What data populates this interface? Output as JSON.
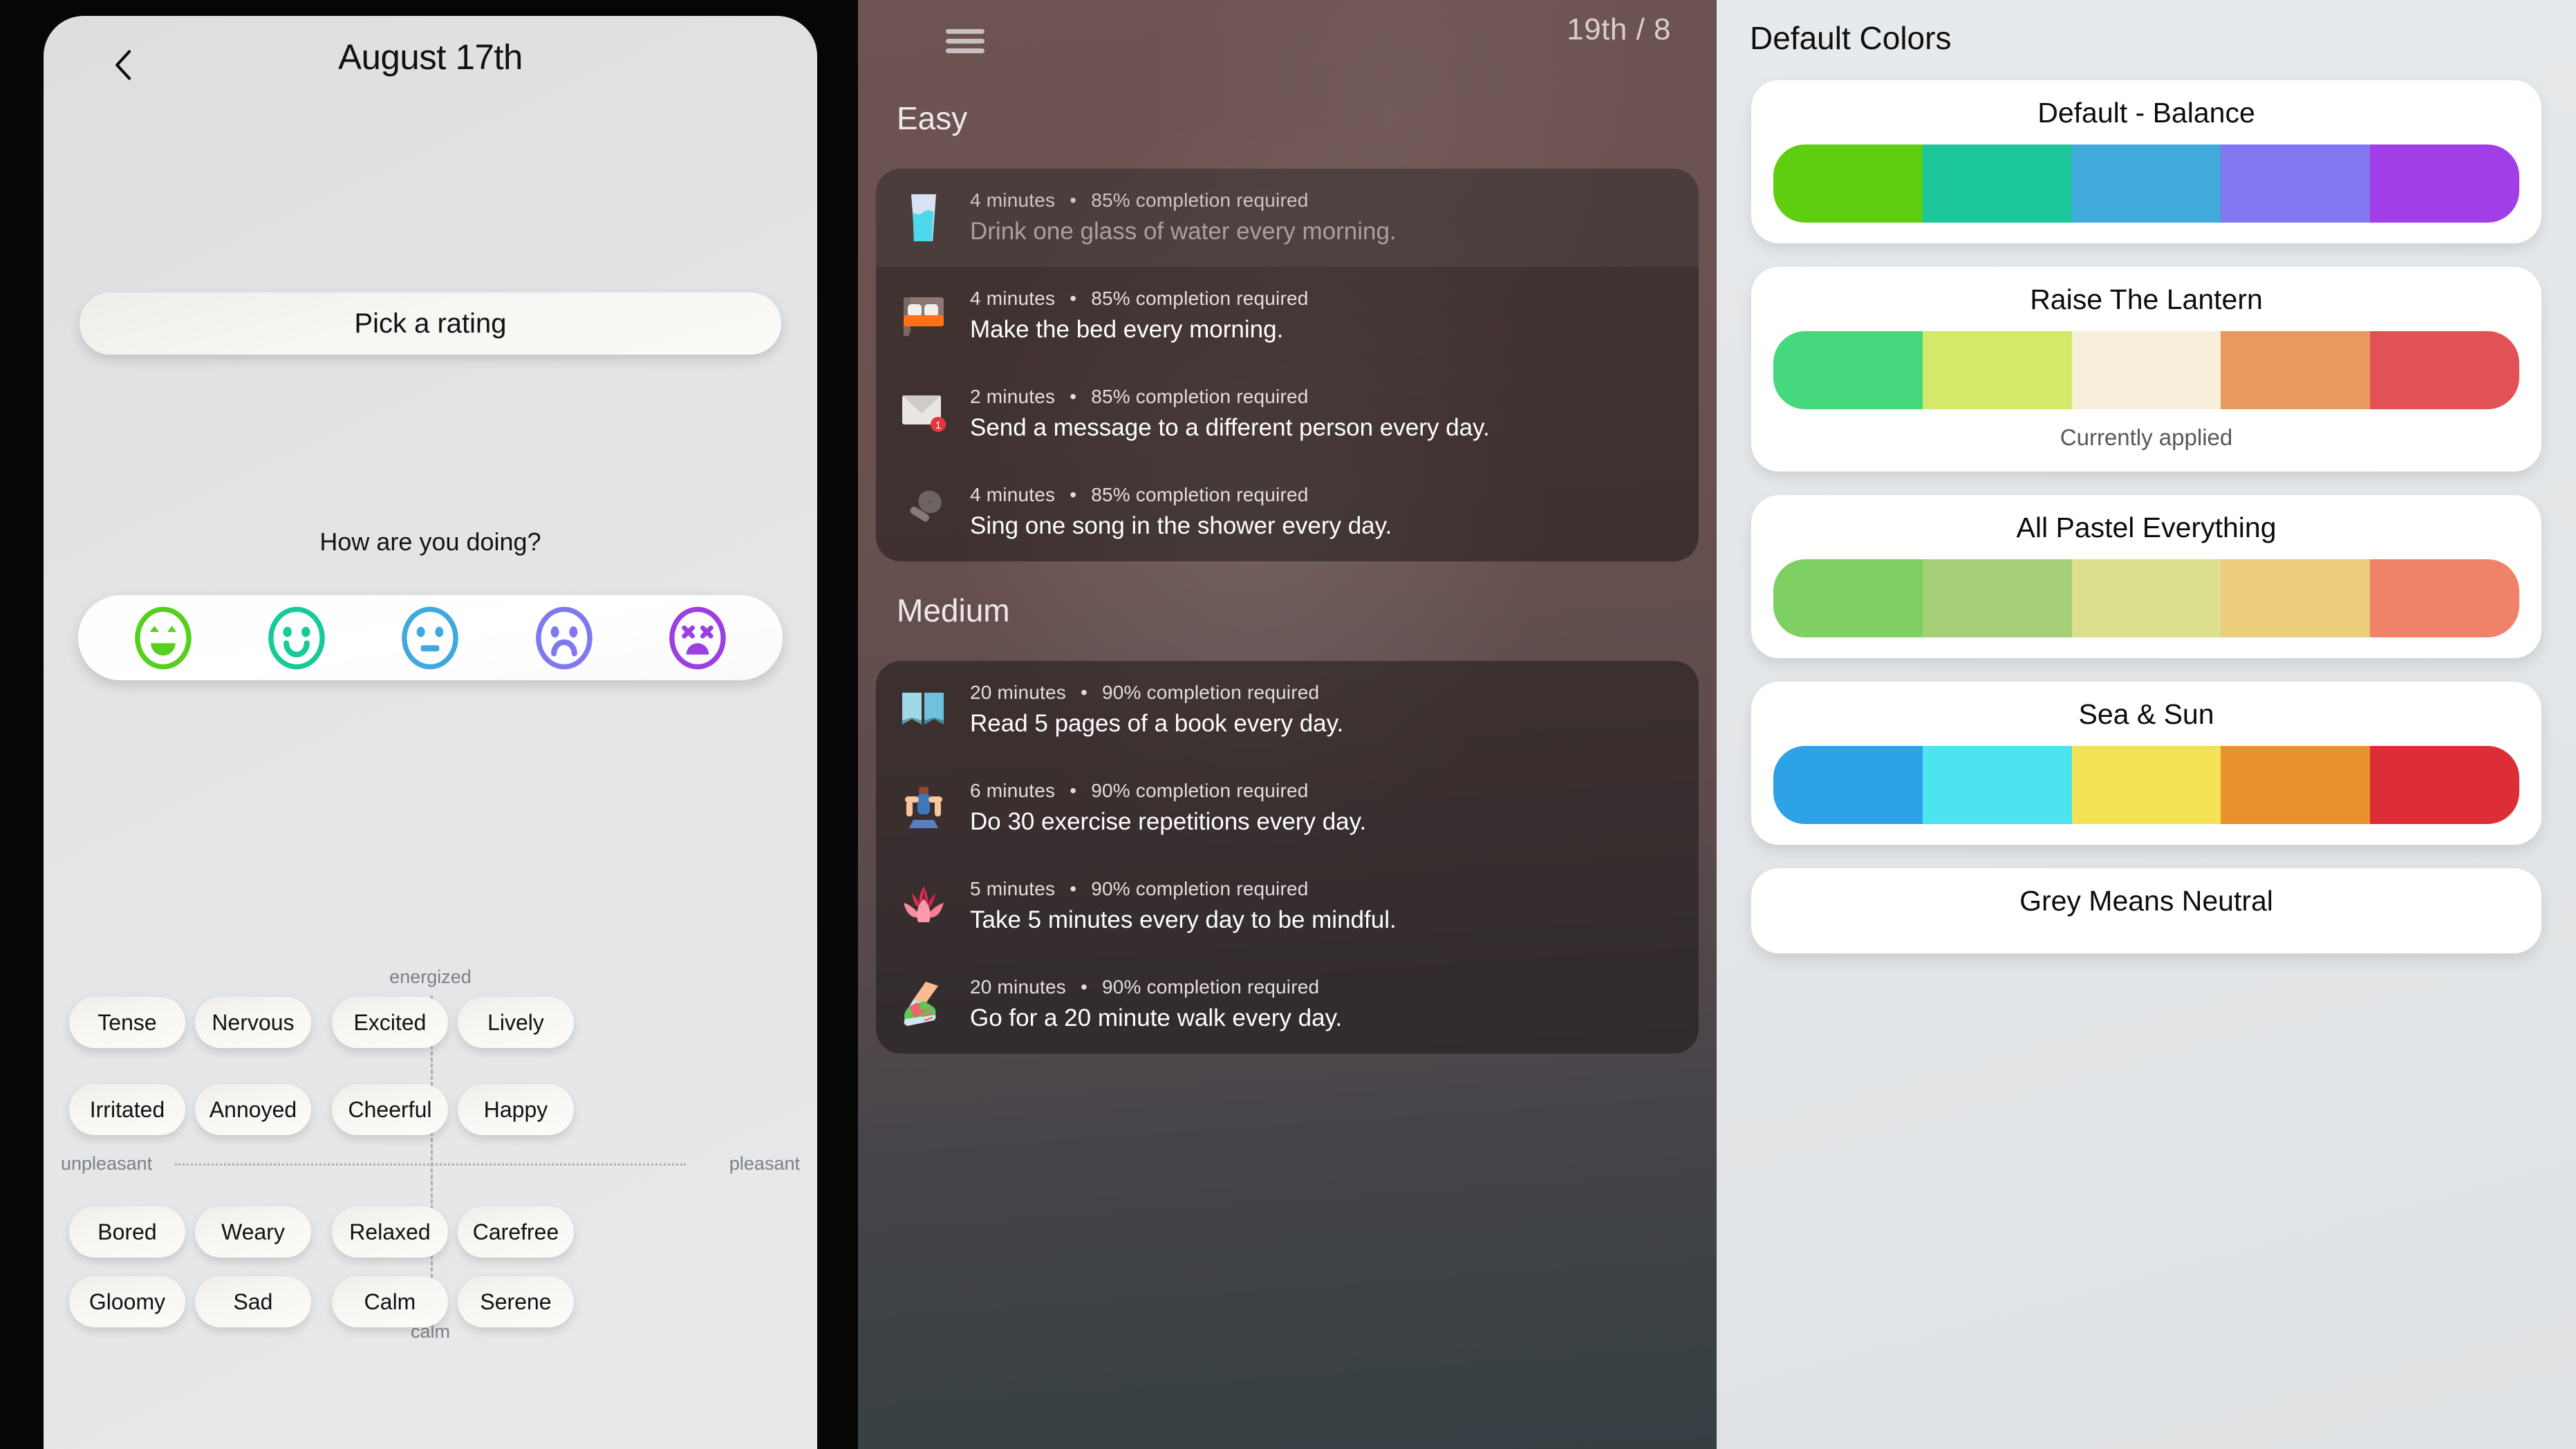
{
  "mood_panel": {
    "back_icon": "chevron-left-icon",
    "date_title": "August 17th",
    "pick_rating_label": "Pick a rating",
    "question": "How are you doing?",
    "ratings": [
      {
        "name": "rating-very-happy",
        "color": "#56cf1e",
        "face": "grin"
      },
      {
        "name": "rating-happy",
        "color": "#18c99a",
        "face": "smile"
      },
      {
        "name": "rating-neutral",
        "color": "#3fa9dd",
        "face": "neutral"
      },
      {
        "name": "rating-sad",
        "color": "#8078ee",
        "face": "frown"
      },
      {
        "name": "rating-very-sad",
        "color": "#9b3fe0",
        "face": "dizzy"
      }
    ],
    "axes": {
      "top": "energized",
      "bottom": "calm",
      "left": "unpleasant",
      "right": "pleasant"
    },
    "mood_rows": [
      [
        "Tense",
        "Nervous",
        "Excited",
        "Lively"
      ],
      [
        "Irritated",
        "Annoyed",
        "Cheerful",
        "Happy"
      ],
      [
        "Bored",
        "Weary",
        "Relaxed",
        "Carefree"
      ],
      [
        "Gloomy",
        "Sad",
        "Calm",
        "Serene"
      ]
    ]
  },
  "habits_panel": {
    "menu_icon": "hamburger-menu-icon",
    "counter": "19th / 8",
    "sections": [
      {
        "title": "Easy",
        "items": [
          {
            "icon": "glass-of-water-icon",
            "duration": "4 minutes",
            "requirement": "85% completion required",
            "text": "Drink one glass of water every morning.",
            "dimmed": true
          },
          {
            "icon": "bed-icon",
            "duration": "4 minutes",
            "requirement": "85% completion required",
            "text": "Make the bed every morning.",
            "dimmed": false
          },
          {
            "icon": "envelope-icon",
            "duration": "2 minutes",
            "requirement": "85% completion required",
            "text": "Send a message to a different person every day.",
            "dimmed": false
          },
          {
            "icon": "microphone-icon",
            "duration": "4 minutes",
            "requirement": "85% completion required",
            "text": "Sing one song in the shower every day.",
            "dimmed": false
          }
        ]
      },
      {
        "title": "Medium",
        "items": [
          {
            "icon": "open-book-icon",
            "duration": "20 minutes",
            "requirement": "90% completion required",
            "text": "Read 5 pages of a book every day.",
            "dimmed": false
          },
          {
            "icon": "exercise-icon",
            "duration": "6 minutes",
            "requirement": "90% completion required",
            "text": "Do 30 exercise repetitions every day.",
            "dimmed": false
          },
          {
            "icon": "lotus-icon",
            "duration": "5 minutes",
            "requirement": "90% completion required",
            "text": "Take 5 minutes every day to be mindful.",
            "dimmed": false
          },
          {
            "icon": "walking-shoe-icon",
            "duration": "20 minutes",
            "requirement": "90% completion required",
            "text": "Go for a 20 minute walk every day.",
            "dimmed": false
          }
        ]
      }
    ],
    "separator": "•"
  },
  "themes_panel": {
    "heading": "Default Colors",
    "applied_label": "Currently applied",
    "themes": [
      {
        "name": "Default - Balance",
        "colors": [
          "#5fcd10",
          "#1bc79b",
          "#41aadd",
          "#8279f0",
          "#a23ee8"
        ],
        "applied": false
      },
      {
        "name": "Raise The Lantern",
        "colors": [
          "#45d87d",
          "#d4e86a",
          "#f7efda",
          "#eb9a5f",
          "#e05256"
        ],
        "applied": true
      },
      {
        "name": "All Pastel Everything",
        "colors": [
          "#7ed063",
          "#a6d077",
          "#dce08e",
          "#ebcd7c",
          "#ef8269"
        ],
        "applied": false
      },
      {
        "name": "Sea & Sun",
        "colors": [
          "#2ea2e6",
          "#4de3ef",
          "#f3e martin"
        ],
        "applied": false
      },
      {
        "name": "Grey Means Neutral",
        "colors": [],
        "applied": false
      }
    ],
    "themes_fixed": [
      {
        "name": "Default - Balance",
        "colors": [
          "#5fcd10",
          "#1bc79b",
          "#41aadd",
          "#8279f0",
          "#a23ee8"
        ],
        "applied": false
      },
      {
        "name": "Raise The Lantern",
        "colors": [
          "#45d87d",
          "#d4e86a",
          "#f7efda",
          "#eb9a5f",
          "#e05256"
        ],
        "applied": true
      },
      {
        "name": "All Pastel Everything",
        "colors": [
          "#7ed063",
          "#a6d077",
          "#dce08e",
          "#ebcd7c",
          "#ef8269"
        ],
        "applied": false
      },
      {
        "name": "Sea & Sun",
        "colors": [
          "#2ea2e6",
          "#4de3ef",
          "#f4e356",
          "#e8922b",
          "#dd2e37"
        ],
        "applied": false
      },
      {
        "name": "Grey Means Neutral",
        "colors": [],
        "applied": false
      }
    ]
  }
}
